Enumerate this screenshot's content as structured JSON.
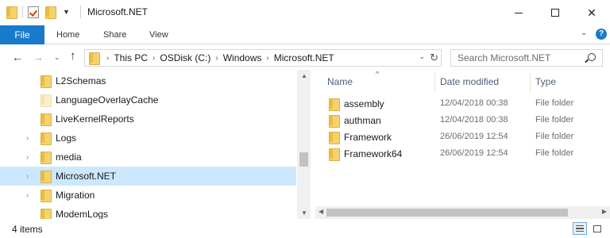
{
  "window": {
    "title": "Microsoft.NET",
    "minimize_glyph": "",
    "maximize_glyph": "",
    "close_glyph": "✕"
  },
  "ribbon": {
    "tabs": [
      {
        "label": "File"
      },
      {
        "label": "Home"
      },
      {
        "label": "Share"
      },
      {
        "label": "View"
      }
    ],
    "expand_glyph": "⌄",
    "help_glyph": "?"
  },
  "nav": {
    "back_glyph": "←",
    "forward_glyph": "→",
    "recent_glyph": "⌄",
    "up_glyph": "↑",
    "breadcrumbs": [
      "This PC",
      "OSDisk (C:)",
      "Windows",
      "Microsoft.NET"
    ],
    "crumb_separator": "›",
    "dropdown_glyph": "⌄",
    "refresh_glyph": "↻",
    "search_placeholder": "Search Microsoft.NET"
  },
  "tree": {
    "items": [
      {
        "label": "L2Schemas",
        "expandable": false,
        "selected": false,
        "pale": false
      },
      {
        "label": "LanguageOverlayCache",
        "expandable": false,
        "selected": false,
        "pale": true
      },
      {
        "label": "LiveKernelReports",
        "expandable": false,
        "selected": false,
        "pale": false
      },
      {
        "label": "Logs",
        "expandable": true,
        "selected": false,
        "pale": false
      },
      {
        "label": "media",
        "expandable": true,
        "selected": false,
        "pale": false
      },
      {
        "label": "Microsoft.NET",
        "expandable": true,
        "selected": true,
        "pale": false
      },
      {
        "label": "Migration",
        "expandable": true,
        "selected": false,
        "pale": false
      },
      {
        "label": "ModemLogs",
        "expandable": false,
        "selected": false,
        "pale": false
      }
    ],
    "expand_glyph": "›"
  },
  "content": {
    "sort_glyph": "^",
    "columns": {
      "name": "Name",
      "date": "Date modified",
      "type": "Type"
    },
    "rows": [
      {
        "name": "assembly",
        "date": "12/04/2018 00:38",
        "type": "File folder"
      },
      {
        "name": "authman",
        "date": "12/04/2018 00:38",
        "type": "File folder"
      },
      {
        "name": "Framework",
        "date": "26/06/2019 12:54",
        "type": "File folder"
      },
      {
        "name": "Framework64",
        "date": "26/06/2019 12:54",
        "type": "File folder"
      }
    ]
  },
  "status": {
    "item_count": "4 items"
  },
  "colors": {
    "accent": "#1979ca",
    "selection": "#cce8ff",
    "header_text": "#4c607a",
    "folder": "#f5d26b"
  }
}
